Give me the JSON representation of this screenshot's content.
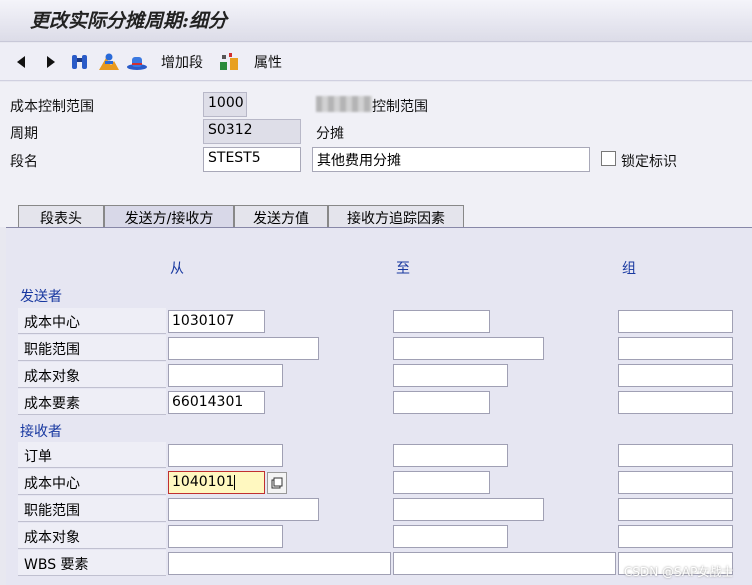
{
  "window": {
    "title": "更改实际分摊周期:细分"
  },
  "toolbar": {
    "add_segment": "增加段",
    "attributes": "属性"
  },
  "header": {
    "controlling_area": {
      "label": "成本控制范围",
      "value": "1000",
      "desc": "控制范围"
    },
    "cycle": {
      "label": "周期",
      "value": "S0312",
      "desc": "分摊"
    },
    "segment": {
      "label": "段名",
      "value": "STEST5",
      "desc": "其他费用分摊"
    },
    "lock_label": "锁定标识"
  },
  "tabs": [
    {
      "label": "段表头"
    },
    {
      "label": "发送方/接收方"
    },
    {
      "label": "发送方值"
    },
    {
      "label": "接收方追踪因素"
    }
  ],
  "columns": {
    "from": "从",
    "to": "至",
    "group": "组"
  },
  "sender": {
    "title": "发送者",
    "rows": [
      {
        "label": "成本中心",
        "from": "1030107"
      },
      {
        "label": "职能范围",
        "from": ""
      },
      {
        "label": "成本对象",
        "from": ""
      },
      {
        "label": "成本要素",
        "from": "66014301"
      }
    ]
  },
  "receiver": {
    "title": "接收者",
    "rows": [
      {
        "label": "订单",
        "from": ""
      },
      {
        "label": "成本中心",
        "from": "1040101"
      },
      {
        "label": "职能范围",
        "from": ""
      },
      {
        "label": "成本对象",
        "from": ""
      },
      {
        "label": "WBS 要素",
        "from": ""
      }
    ]
  },
  "watermark": "CSDN @SAP女战士"
}
